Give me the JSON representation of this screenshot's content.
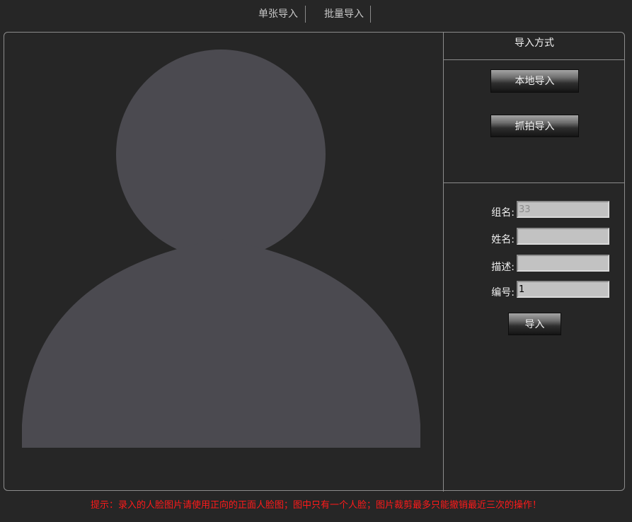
{
  "tabs": [
    {
      "label": "单张导入"
    },
    {
      "label": "批量导入"
    }
  ],
  "panel": {
    "title": "导入方式",
    "local_import_label": "本地导入",
    "capture_import_label": "抓拍导入"
  },
  "form": {
    "group_label": "组名:",
    "group_placeholder": "33",
    "name_label": "姓名:",
    "name_value": "",
    "desc_label": "描述:",
    "desc_value": "",
    "number_label": "编号:",
    "number_value": "1",
    "submit_label": "导入"
  },
  "avatar": {
    "icon": "person-silhouette-icon",
    "fill_color": "#4b4a50"
  },
  "hint": "提示：录入的人脸图片请使用正向的正面人脸图；图中只有一个人脸；图片裁剪最多只能撤销最近三次的操作！",
  "colors": {
    "background": "#262626",
    "border": "#8c8c8c",
    "hint_red": "#ff1a1a"
  }
}
